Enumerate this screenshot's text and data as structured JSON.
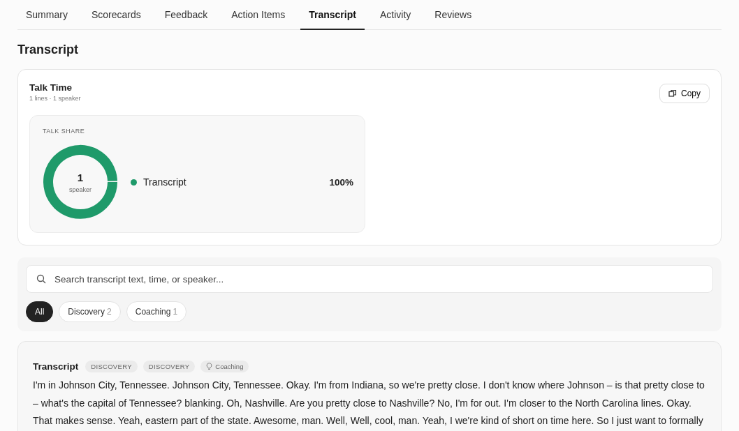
{
  "tabs": [
    {
      "label": "Summary",
      "selected": false
    },
    {
      "label": "Scorecards",
      "selected": false
    },
    {
      "label": "Feedback",
      "selected": false
    },
    {
      "label": "Action Items",
      "selected": false
    },
    {
      "label": "Transcript",
      "selected": true
    },
    {
      "label": "Activity",
      "selected": false
    },
    {
      "label": "Reviews",
      "selected": false
    }
  ],
  "page_title": "Transcript",
  "talk_time": {
    "title": "Talk Time",
    "subtitle": "1 lines · 1 speaker",
    "copy_button": "Copy",
    "talk_share": {
      "heading": "TALK SHARE",
      "center_value": "1",
      "center_label": "speaker",
      "legend": [
        {
          "name": "Transcript",
          "color": "#1f9a6a",
          "percent": "100%"
        }
      ]
    }
  },
  "search": {
    "placeholder": "Search transcript text, time, or speaker..."
  },
  "filters": [
    {
      "label": "All",
      "selected": true
    },
    {
      "label": "Discovery",
      "count": "2",
      "selected": false
    },
    {
      "label": "Coaching",
      "count": "1",
      "selected": false
    }
  ],
  "entries": [
    {
      "speaker": "Transcript",
      "tags": [
        {
          "kind": "label",
          "text": "DISCOVERY"
        },
        {
          "kind": "label",
          "text": "DISCOVERY"
        },
        {
          "kind": "coaching",
          "text": "Coaching"
        }
      ],
      "text": "I'm in Johnson City, Tennessee. Johnson City, Tennessee. Okay. I'm from Indiana, so we're pretty close. I don't know where Johnson – is that pretty close to – what's the capital of Tennessee? blanking. Oh, Nashville. Are you pretty close to Nashville? No, I'm for out. I'm closer to the North Carolina lines. Okay. That makes sense. Yeah, eastern part of the state. Awesome, man. Well, Well, cool, man. Yeah, I we're kind of short on time here. So I just want to formally"
    }
  ]
}
